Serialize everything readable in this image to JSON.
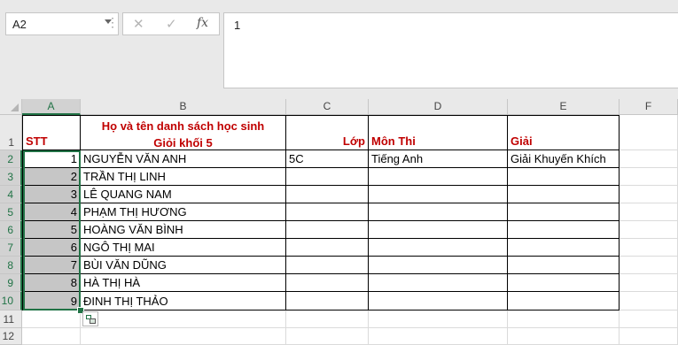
{
  "name_box": {
    "value": "A2"
  },
  "formula_bar": {
    "cancel_glyph": "✕",
    "enter_glyph": "✓",
    "fx_glyph": "fx",
    "value": "1"
  },
  "columns": [
    "A",
    "B",
    "C",
    "D",
    "E",
    "F"
  ],
  "rows": [
    "1",
    "2",
    "3",
    "4",
    "5",
    "6",
    "7",
    "8",
    "9",
    "10",
    "11",
    "12"
  ],
  "header_row": {
    "a": "STT",
    "b_line1": "Họ và tên danh sách học sinh",
    "b_line2": "Giỏi khối 5",
    "c": "Lớp",
    "d": "Môn Thi",
    "e": "Giải"
  },
  "data_rows": [
    {
      "stt": "1",
      "name": "NGUYỄN VĂN ANH",
      "class": "5C",
      "subject": "Tiếng Anh",
      "award": "Giải Khuyến Khích"
    },
    {
      "stt": "2",
      "name": "TRẦN THỊ LINH",
      "class": "",
      "subject": "",
      "award": ""
    },
    {
      "stt": "3",
      "name": "LÊ QUANG NAM",
      "class": "",
      "subject": "",
      "award": ""
    },
    {
      "stt": "4",
      "name": "PHẠM THỊ HƯƠNG",
      "class": "",
      "subject": "",
      "award": ""
    },
    {
      "stt": "5",
      "name": "HOÀNG VĂN BÌNH",
      "class": "",
      "subject": "",
      "award": ""
    },
    {
      "stt": "6",
      "name": "NGÔ THỊ MAI",
      "class": "",
      "subject": "",
      "award": ""
    },
    {
      "stt": "7",
      "name": "BÙI VĂN DŨNG",
      "class": "",
      "subject": "",
      "award": ""
    },
    {
      "stt": "8",
      "name": "HÀ THỊ HÀ",
      "class": "",
      "subject": "",
      "award": ""
    },
    {
      "stt": "9",
      "name": "ĐINH THỊ THẢO",
      "class": "",
      "subject": "",
      "award": ""
    }
  ],
  "colors": {
    "accent": "#217346",
    "header_text": "#c00000",
    "selection_fill": "#c6c6c6"
  }
}
